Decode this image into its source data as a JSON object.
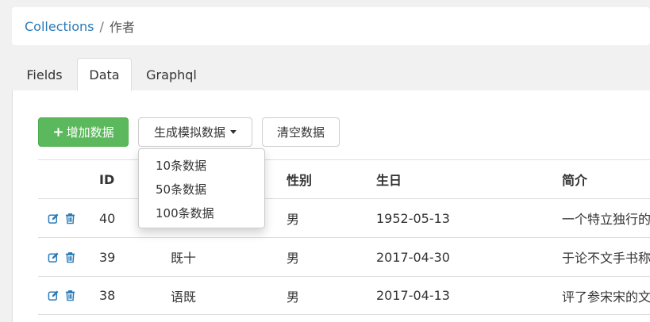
{
  "breadcrumb": {
    "root": "Collections",
    "separator": "/",
    "current": "作者"
  },
  "tabs": [
    {
      "label": "Fields",
      "active": false
    },
    {
      "label": "Data",
      "active": true
    },
    {
      "label": "Graphql",
      "active": false
    }
  ],
  "toolbar": {
    "add_icon": "+",
    "add_label": "增加数据",
    "mock_label": "生成模拟数据",
    "clear_label": "清空数据"
  },
  "mock_menu": {
    "items": [
      "10条数据",
      "50条数据",
      "100条数据"
    ]
  },
  "table": {
    "headers": {
      "id": "ID",
      "name": "",
      "gender": "性别",
      "birthday": "生日",
      "intro": "简介"
    },
    "rows": [
      {
        "id": "40",
        "name": "",
        "gender": "男",
        "birthday": "1952-05-13",
        "intro": "一个特立独行的"
      },
      {
        "id": "39",
        "name": "既十",
        "gender": "男",
        "birthday": "2017-04-30",
        "intro": "于论不文手书称"
      },
      {
        "id": "38",
        "name": "语既",
        "gender": "男",
        "birthday": "2017-04-13",
        "intro": "评了参宋宋的文"
      }
    ]
  },
  "colors": {
    "link": "#2a7ab8",
    "success": "#5cb85c",
    "icon": "#2a7ab8",
    "border": "#dddddd"
  },
  "icons": {
    "edit": "edit-icon",
    "delete": "trash-icon",
    "caret": "caret-down-icon"
  }
}
